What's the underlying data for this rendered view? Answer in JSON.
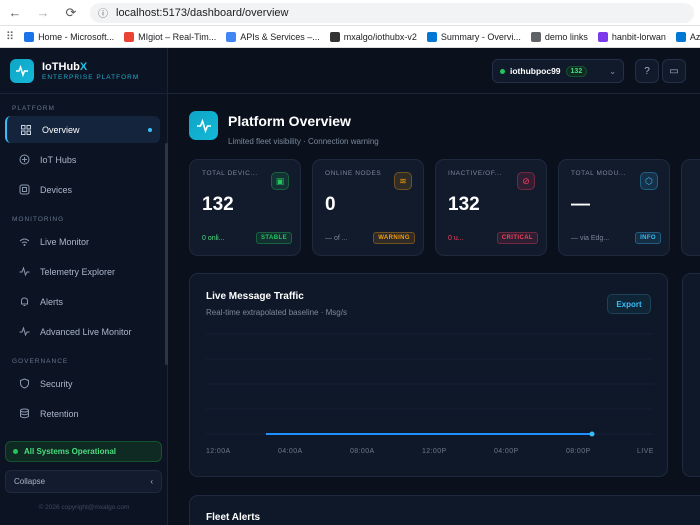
{
  "browser": {
    "url": "localhost:5173/dashboard/overview",
    "bookmarks": [
      {
        "label": "Home - Microsoft...",
        "color": "#1a73e8"
      },
      {
        "label": "MIgiot – Real-Tim...",
        "color": "#ea4335"
      },
      {
        "label": "APIs & Services –...",
        "color": "#4285f4"
      },
      {
        "label": "mxalgo/iothubx-v2",
        "color": "#333333"
      },
      {
        "label": "Summary - Overvi...",
        "color": "#0078d4"
      },
      {
        "label": "demo links",
        "color": "#5f6368"
      },
      {
        "label": "hanbit-lorwan",
        "color": "#7c3aed"
      },
      {
        "label": "Azure",
        "color": "#0078d4"
      }
    ]
  },
  "brand": {
    "name": "IoTHub",
    "name_accent": "X",
    "subtitle": "ENTERPRISE PLATFORM"
  },
  "sidebar": {
    "sections": {
      "platform": "PLATFORM",
      "monitoring": "MONITORING",
      "governance": "GOVERNANCE"
    },
    "items": [
      {
        "label": "Overview",
        "icon": "grid-icon"
      },
      {
        "label": "IoT Hubs",
        "icon": "hub-icon"
      },
      {
        "label": "Devices",
        "icon": "chip-icon"
      },
      {
        "label": "Live Monitor",
        "icon": "signal-icon"
      },
      {
        "label": "Telemetry Explorer",
        "icon": "pulse-icon"
      },
      {
        "label": "Alerts",
        "icon": "bell-icon"
      },
      {
        "label": "Advanced Live Monitor",
        "icon": "pulse-icon"
      },
      {
        "label": "Security",
        "icon": "shield-icon"
      },
      {
        "label": "Retention",
        "icon": "database-icon"
      }
    ],
    "status": "All Systems Operational",
    "collapse": "Collapse",
    "copyright": "© 2026 copyright@mxalgo.com"
  },
  "topbar": {
    "hub_name": "iothubpoc99",
    "hub_count": "132"
  },
  "page": {
    "title": "Platform Overview",
    "subtitle": "Limited fleet visibility · Connection warning"
  },
  "stats": [
    {
      "label": "TOTAL DEVIC...",
      "value": "132",
      "note": "0 onli...",
      "badge": "STABLE",
      "color": "#22c55e"
    },
    {
      "label": "ONLINE NODES",
      "value": "0",
      "note": "— of ...",
      "badge": "WARNING",
      "color": "#f59e0b"
    },
    {
      "label": "INACTIVE/OF...",
      "value": "132",
      "note": "0 u...",
      "badge": "CRITICAL",
      "color": "#f43f5e"
    },
    {
      "label": "TOTAL MODU...",
      "value": "—",
      "note": "— via Edg...",
      "badge": "INFO",
      "color": "#38bdf8"
    }
  ],
  "traffic": {
    "title": "Live Message Traffic",
    "subtitle": "Real-time extrapolated baseline · Msg/s",
    "export": "Export"
  },
  "chart_data": {
    "type": "line",
    "title": "Live Message Traffic",
    "xlabel": "",
    "ylabel": "Msg/s",
    "categories": [
      "12:00A",
      "04:00A",
      "08:00A",
      "12:00P",
      "04:00P",
      "08:00P",
      "LIVE"
    ],
    "series": [
      {
        "values": [
          0,
          0,
          0,
          0,
          0,
          0
        ]
      }
    ],
    "grid": true
  },
  "alerts": {
    "title": "Fleet Alerts"
  }
}
